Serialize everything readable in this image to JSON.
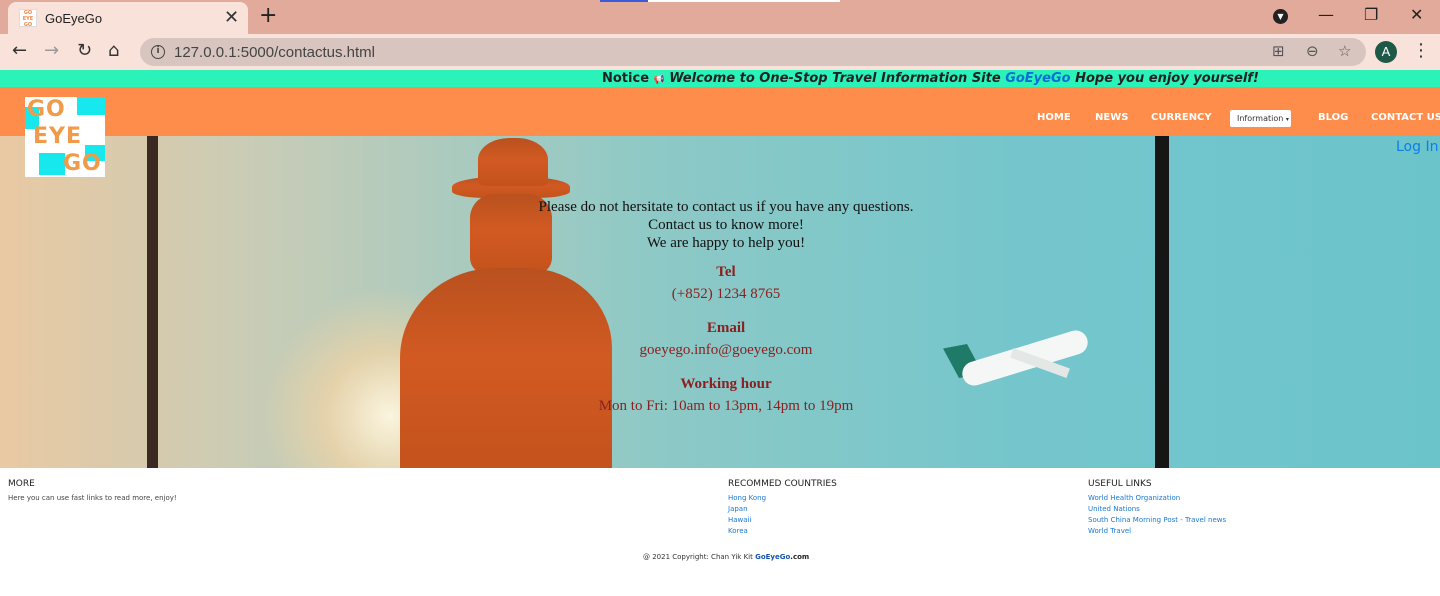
{
  "browser": {
    "tab_title": "GoEyeGo",
    "tab_close": "✕",
    "new_tab": "+",
    "url": "127.0.0.1:5000/contactus.html",
    "profile_initial": "A",
    "icons": [
      "back-arrow-icon",
      "forward-arrow-icon",
      "reload-icon",
      "home-icon",
      "info-icon",
      "translate-icon",
      "zoom-icon",
      "star-icon",
      "menu-dots-icon"
    ]
  },
  "notice": {
    "label": "Notice",
    "megaphone": "📢",
    "welcome": "Welcome to One-Stop Travel Information Site",
    "brand": "GoEyeGo",
    "tail": "Hope you enjoy yourself!"
  },
  "logo": {
    "line1": "GO",
    "line2": "EYE",
    "line3": "GO"
  },
  "nav": {
    "home": "HOME",
    "news": "NEWS",
    "currency": "CURRENCY",
    "information": "Information",
    "blog": "BLOG",
    "contact": "CONTACT US",
    "login": "Log In"
  },
  "contact": {
    "intro1": "Please do not hersitate to contact us if you have any questions.",
    "intro2": "Contact us to know more!",
    "intro3": "We are happy to help you!",
    "tel_label": "Tel",
    "tel_value": "(+852) 1234 8765",
    "email_label": "Email",
    "email_value": "goeyego.info@goeyego.com",
    "hours_label": "Working hour",
    "hours_value": "Mon to Fri: 10am to 13pm, 14pm to 19pm"
  },
  "footer": {
    "more_title": "MORE",
    "more_text": "Here you can use fast links to read more, enjoy!",
    "countries_title": "RECOMMED COUNTRIES",
    "countries": [
      "Hong Kong",
      "Japan",
      "Hawaii",
      "Korea"
    ],
    "links_title": "USEFUL LINKS",
    "links": [
      "World Health Organization",
      "United Nations",
      "South China Morning Post - Travel news",
      "World Travel"
    ],
    "copyright_prefix": "@ 2021 Copyright: Chan Yik Kit",
    "copyright_brand": "GoEyeGo",
    "copyright_suffix": ".com"
  },
  "colors": {
    "tabbar": "#e2aa9b",
    "notice_bar": "#2af2b9",
    "navbar": "#fe8c4a",
    "accent_blue": "#0d7ee8",
    "contact_heading": "#8b2020"
  }
}
